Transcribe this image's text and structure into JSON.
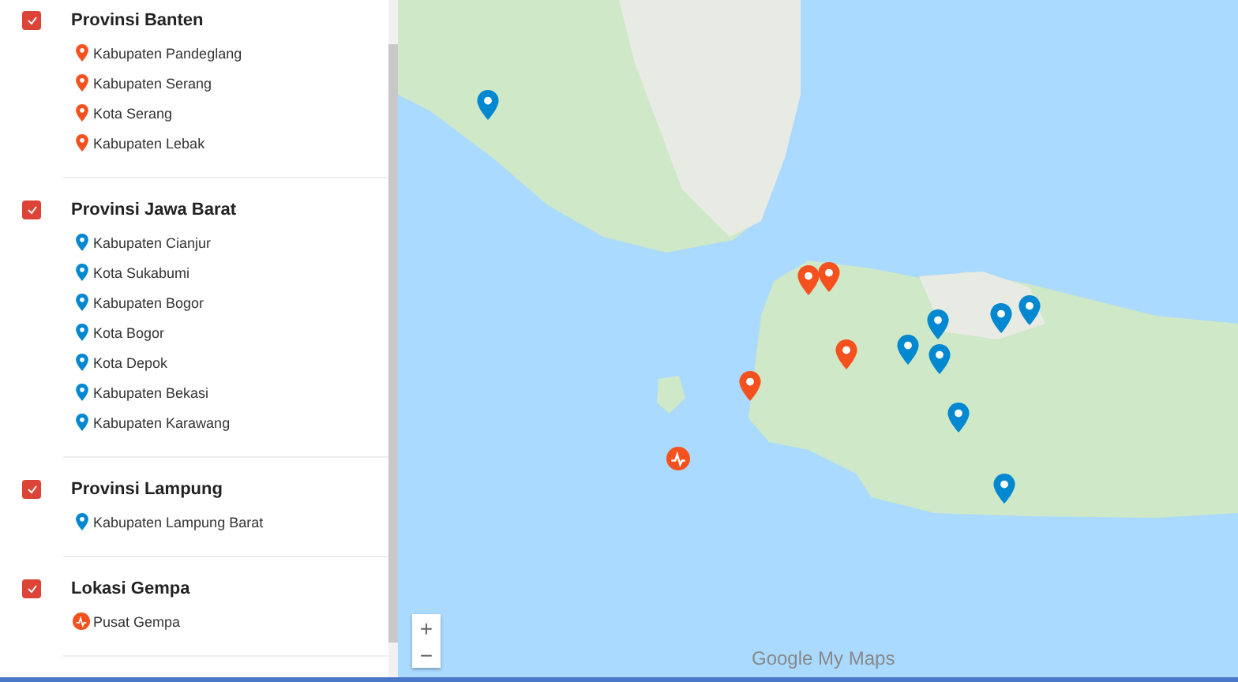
{
  "layers": [
    {
      "title": "Provinsi Banten",
      "checked": true,
      "items": [
        {
          "label": "Kabupaten Pandeglang",
          "kind": "pin",
          "color": "#f4511e"
        },
        {
          "label": "Kabupaten Serang",
          "kind": "pin",
          "color": "#f4511e"
        },
        {
          "label": "Kota Serang",
          "kind": "pin",
          "color": "#f4511e"
        },
        {
          "label": "Kabupaten Lebak",
          "kind": "pin",
          "color": "#f4511e"
        }
      ]
    },
    {
      "title": "Provinsi Jawa Barat",
      "checked": true,
      "items": [
        {
          "label": "Kabupaten Cianjur",
          "kind": "pin",
          "color": "#0288d1"
        },
        {
          "label": "Kota Sukabumi",
          "kind": "pin",
          "color": "#0288d1"
        },
        {
          "label": "Kabupaten Bogor",
          "kind": "pin",
          "color": "#0288d1"
        },
        {
          "label": "Kota Bogor",
          "kind": "pin",
          "color": "#0288d1"
        },
        {
          "label": "Kota Depok",
          "kind": "pin",
          "color": "#0288d1"
        },
        {
          "label": "Kabupaten Bekasi",
          "kind": "pin",
          "color": "#0288d1"
        },
        {
          "label": "Kabupaten Karawang",
          "kind": "pin",
          "color": "#0288d1"
        }
      ]
    },
    {
      "title": "Provinsi Lampung",
      "checked": true,
      "items": [
        {
          "label": "Kabupaten Lampung Barat",
          "kind": "pin",
          "color": "#0288d1"
        }
      ]
    },
    {
      "title": "Lokasi Gempa",
      "checked": true,
      "items": [
        {
          "label": "Pusat Gempa",
          "kind": "quake",
          "color": "#f4511e"
        }
      ]
    }
  ],
  "map": {
    "zoom_in": "+",
    "zoom_out": "−",
    "logo": "Google My Maps"
  }
}
